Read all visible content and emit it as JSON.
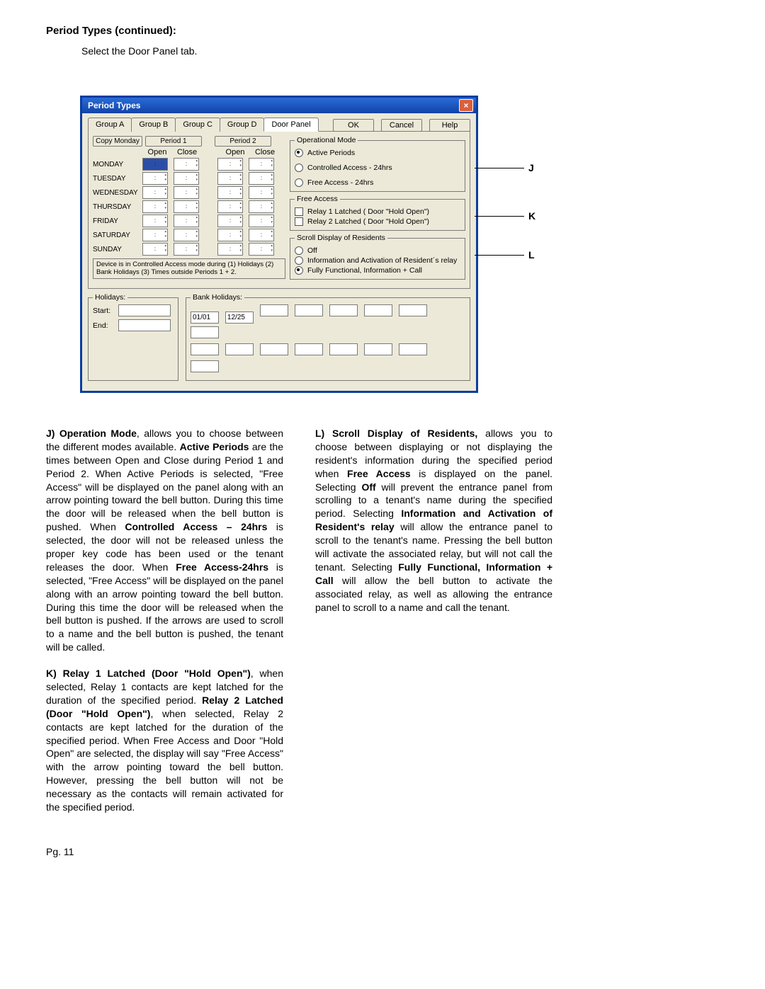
{
  "page": {
    "heading": "Period Types (continued):",
    "intro": "Select the Door Panel tab.",
    "footer": "Pg. 11"
  },
  "dialog": {
    "title": "Period Types",
    "tabs": [
      "Group A",
      "Group B",
      "Group C",
      "Group D",
      "Door Panel"
    ],
    "active_tab": 4,
    "buttons": {
      "ok": "OK",
      "cancel": "Cancel",
      "help": "Help"
    },
    "copy_btn": "Copy Monday",
    "period1_btn": "Period 1",
    "period2_btn": "Period 2",
    "column_headers": [
      "Open",
      "Close",
      "Open",
      "Close"
    ],
    "days": [
      "MONDAY",
      "TUESDAY",
      "WEDNESDAY",
      "THURSDAY",
      "FRIDAY",
      "SATURDAY",
      "SUNDAY"
    ],
    "note": "Device is in Controlled Access mode during (1) Holidays (2) Bank Holidays (3) Times outside Periods 1 + 2.",
    "op_mode": {
      "legend": "Operational Mode",
      "active_periods": "Active Periods",
      "controlled": "Controlled Access - 24hrs",
      "free": "Free Access - 24hrs"
    },
    "free_access": {
      "legend": "Free Access",
      "relay1": "Relay 1 Latched ( Door \"Hold Open\")",
      "relay2": "Relay 2 Latched ( Door \"Hold Open\")"
    },
    "scroll": {
      "legend": "Scroll Display of Residents",
      "off": "Off",
      "info_act": "Information and Activation of Resident´s relay",
      "full": "Fully Functional, Information + Call"
    },
    "holidays": {
      "legend": "Holidays:",
      "start": "Start:",
      "end": "End:"
    },
    "bank": {
      "legend": "Bank Holidays:",
      "v1": "01/01",
      "v2": "12/25"
    }
  },
  "callouts": {
    "j": "J",
    "k": "K",
    "l": "L"
  },
  "text": {
    "j_para": "<span class=\"b\">J) Operation Mode</span>, allows you to choose between the different modes available.  <span class=\"b\">Active Periods</span> are the times between Open and Close during Period 1 and Period 2.  When Active Periods is selected, \"Free Access\" will be displayed on the panel along with an arrow pointing toward the bell button.  During this time the door will be released when the bell button is pushed.  When <span class=\"b\">Controlled Access – 24hrs</span> is selected, the door will not be released unless the proper key code has been used or the tenant releases the door.  When <span class=\"b\">Free Access-24hrs</span> is selected, \"Free Access\" will be displayed on the panel along with an arrow pointing toward the bell button.  During this time the door will be released when the bell button is pushed.  If the arrows are used to scroll to a name and the bell button is pushed, the tenant will be called.",
    "k_para": "<span class=\"b\">K) Relay 1 Latched (Door \"Hold Open\")</span>, when selected, Relay 1 contacts are kept latched for the duration of the specified period.  <span class=\"b\">Relay 2 Latched (Door \"Hold Open\")</span>, when selected, Relay 2 contacts are kept latched for the duration of the specified period.  When Free Access and Door \"Hold Open\" are selected, the display will say \"Free Access\" with the arrow pointing toward the bell button.  However, pressing the bell button will not be necessary as the contacts will remain activated for the specified period.",
    "l_para": "<span class=\"b\">L) Scroll Display of Residents,</span> allows you to choose between displaying or not displaying the resident's information during the specified period when <span class=\"b\">Free Access</span> is displayed on the panel.  Selecting <span class=\"b\">Off</span> will prevent the entrance panel from scrolling to a tenant's name during the specified period.  Selecting <span class=\"b\">Information and Activation of Resident's relay</span> will allow the entrance panel to scroll to the tenant's name. Pressing the bell button will activate the associated relay, but will not call the tenant.  Selecting <span class=\"b\">Fully Functional, Information + Call</span> will  allow the bell button to activate the associated relay, as well as allowing the entrance panel to scroll to a name and call the tenant."
  }
}
